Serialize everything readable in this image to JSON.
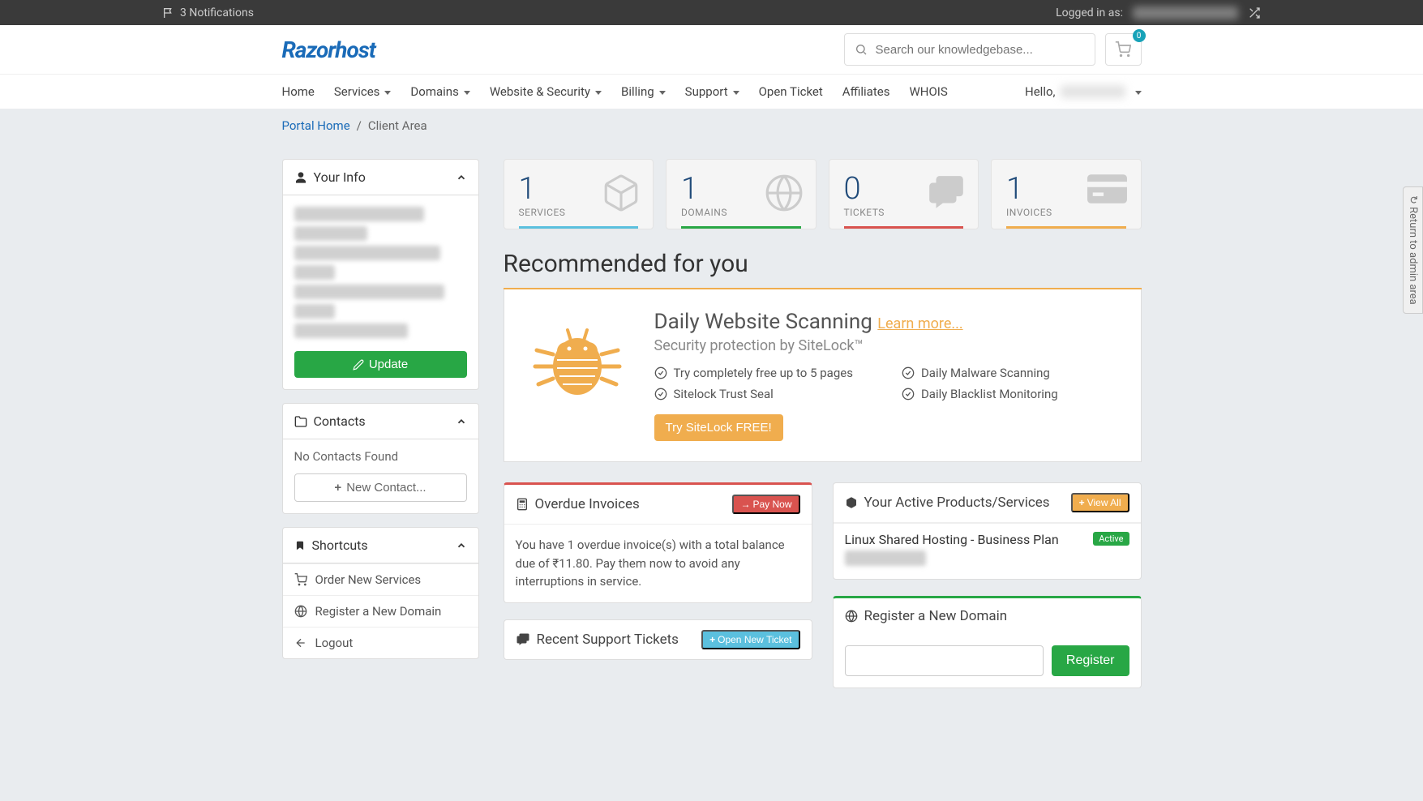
{
  "topbar": {
    "notifications": "3 Notifications",
    "logged_in_label": "Logged in as:"
  },
  "header": {
    "logo": "Razorhost",
    "search_placeholder": "Search our knowledgebase...",
    "cart_count": "0"
  },
  "nav": {
    "home": "Home",
    "services": "Services",
    "domains": "Domains",
    "website_security": "Website & Security",
    "billing": "Billing",
    "support": "Support",
    "open_ticket": "Open Ticket",
    "affiliates": "Affiliates",
    "whois": "WHOIS",
    "hello": "Hello,"
  },
  "breadcrumb": {
    "home": "Portal Home",
    "sep": "/",
    "current": "Client Area"
  },
  "sidebar": {
    "your_info": {
      "title": "Your Info",
      "update_btn": "Update"
    },
    "contacts": {
      "title": "Contacts",
      "empty": "No Contacts Found",
      "new_btn": "New Contact..."
    },
    "shortcuts": {
      "title": "Shortcuts",
      "items": [
        "Order New Services",
        "Register a New Domain",
        "Logout"
      ]
    }
  },
  "stats": [
    {
      "value": "1",
      "label": "SERVICES",
      "color": "#5bc0de"
    },
    {
      "value": "1",
      "label": "DOMAINS",
      "color": "#28a745"
    },
    {
      "value": "0",
      "label": "TICKETS",
      "color": "#d9534f"
    },
    {
      "value": "1",
      "label": "INVOICES",
      "color": "#f0ad4e"
    }
  ],
  "reco": {
    "heading": "Recommended for you",
    "title": "Daily Website Scanning",
    "learn_more": "Learn more...",
    "subtitle": "Security protection by SiteLock™",
    "features_left": [
      "Try completely free up to 5 pages",
      "Sitelock Trust Seal"
    ],
    "features_right": [
      "Daily Malware Scanning",
      "Daily Blacklist Monitoring"
    ],
    "cta": "Try SiteLock FREE!"
  },
  "overdue": {
    "title": "Overdue Invoices",
    "pay_btn": "Pay Now",
    "body": "You have 1 overdue invoice(s) with a total balance due of ₹11.80. Pay them now to avoid any interruptions in service."
  },
  "tickets": {
    "title": "Recent Support Tickets",
    "open_btn": "Open New Ticket"
  },
  "products": {
    "title": "Your Active Products/Services",
    "view_all": "View All",
    "item_name": "Linux Shared Hosting - Business Plan",
    "status": "Active"
  },
  "register_domain": {
    "title": "Register a New Domain",
    "btn": "Register"
  },
  "side_tab": "Return to admin area"
}
